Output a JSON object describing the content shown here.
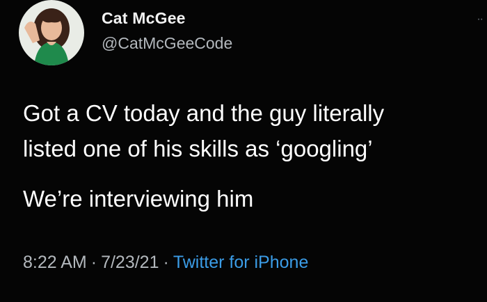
{
  "tweet": {
    "author_name": "Cat McGee",
    "author_handle": "@CatMcGeeCode",
    "body_lines": [
      "Got a CV today and the guy literally",
      "listed one of his skills as ‘googling’",
      "We’re interviewing him"
    ],
    "time": "8:22 AM",
    "date": "7/23/21",
    "separator": "·",
    "source": "Twitter for iPhone",
    "more_icon": "ellipsis-icon"
  },
  "colors": {
    "background": "#050505",
    "text_primary": "#ffffff",
    "text_secondary": "#b3b8bd",
    "link": "#3b9ce6"
  }
}
